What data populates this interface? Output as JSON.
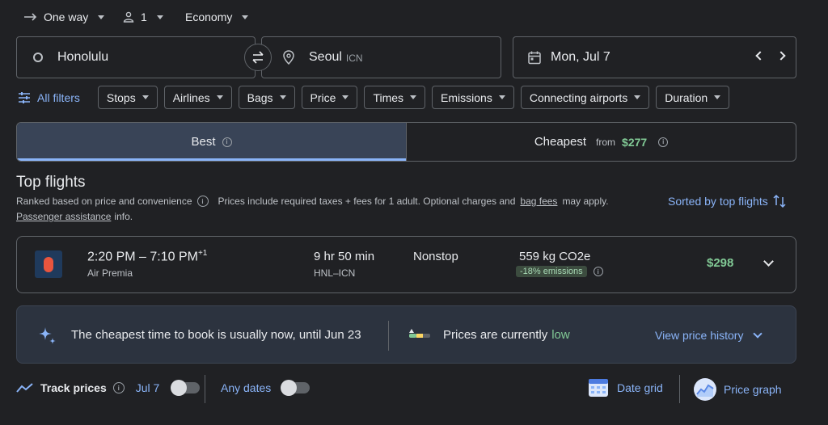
{
  "trip": {
    "trip_type": "One way",
    "passengers": "1",
    "cabin_class": "Economy"
  },
  "search": {
    "origin": "Honolulu",
    "destination": "Seoul",
    "destination_code": "ICN",
    "date": "Mon, Jul 7"
  },
  "filters": {
    "all_filters_label": "All filters",
    "chips": [
      "Stops",
      "Airlines",
      "Bags",
      "Price",
      "Times",
      "Emissions",
      "Connecting airports",
      "Duration"
    ]
  },
  "sort_tabs": {
    "best_label": "Best",
    "cheapest_label": "Cheapest",
    "cheapest_from": "from",
    "cheapest_price": "$277"
  },
  "results": {
    "heading": "Top flights",
    "ranking_note": "Ranked based on price and convenience",
    "price_note_prefix": "Prices include required taxes + fees for 1 adult. Optional charges and",
    "bag_fees_link": "bag fees",
    "price_note_suffix": "may apply.",
    "passenger_link": "Passenger assistance",
    "passenger_suffix": "info.",
    "sort_label": "Sorted by top flights"
  },
  "flight": {
    "times": "2:20 PM – 7:10 PM",
    "day_offset": "+1",
    "airline": "Air Premia",
    "duration": "9 hr 50 min",
    "route": "HNL–ICN",
    "stops": "Nonstop",
    "emissions": "559 kg CO2e",
    "emissions_delta": "-18% emissions",
    "price": "$298"
  },
  "insights": {
    "cheapest_time": "The cheapest time to book is usually now, until Jun 23",
    "prices_prefix": "Prices are currently",
    "price_level": "low",
    "history_link": "View price history"
  },
  "tools": {
    "track_label": "Track prices",
    "track_date": "Jul 7",
    "any_dates": "Any dates",
    "date_grid": "Date grid",
    "price_graph": "Price graph"
  },
  "colors": {
    "accent": "#8ab4f8",
    "price_green": "#81c995",
    "airline_logo": "#e8553e"
  }
}
